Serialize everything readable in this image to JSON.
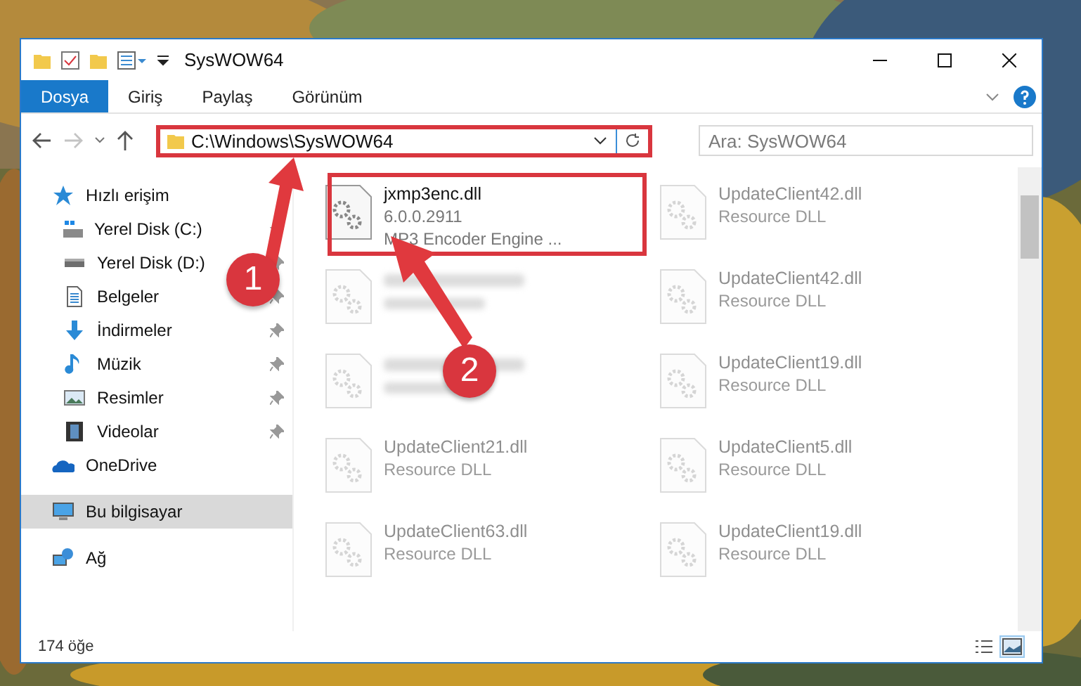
{
  "window": {
    "title": "SysWOW64"
  },
  "ribbon_tabs": [
    {
      "label": "Dosya",
      "kind": "file"
    },
    {
      "label": "Giriş",
      "kind": "tab"
    },
    {
      "label": "Paylaş",
      "kind": "tab"
    },
    {
      "label": "Görünüm",
      "kind": "tab"
    }
  ],
  "navigation": {
    "back": {
      "disabled": false
    },
    "forward": {
      "disabled": true
    }
  },
  "address": {
    "path": "C:\\Windows\\SysWOW64"
  },
  "search": {
    "placeholder": "Ara: SysWOW64"
  },
  "sidebar": {
    "items": [
      {
        "label": "Hızlı erişim",
        "kind": "quick_access",
        "selected": false,
        "children": [
          {
            "label": "Yerel Disk (C:)",
            "kind": "system_drive",
            "pinned": true,
            "selected": false
          },
          {
            "label": "Yerel Disk (D:)",
            "kind": "drive",
            "pinned": true,
            "selected": false
          },
          {
            "label": "Belgeler",
            "kind": "documents",
            "pinned": true,
            "selected": false
          },
          {
            "label": "İndirmeler",
            "kind": "downloads",
            "pinned": true,
            "selected": false
          },
          {
            "label": "Müzik",
            "kind": "music",
            "pinned": true,
            "selected": false
          },
          {
            "label": "Resimler",
            "kind": "pictures",
            "pinned": true,
            "selected": false
          },
          {
            "label": "Videolar",
            "kind": "videos",
            "pinned": true,
            "selected": false
          }
        ]
      },
      {
        "label": "OneDrive",
        "kind": "cloud",
        "selected": false
      },
      {
        "label": "Bu bilgisayar",
        "kind": "computer",
        "selected": true
      },
      {
        "label": "Ağ",
        "kind": "network",
        "selected": false
      }
    ]
  },
  "files": [
    {
      "kind": "file",
      "name": "jxmp3enc.dll",
      "version": "6.0.0.2911",
      "description": "MP3 Encoder Engine ...",
      "blurred": false
    },
    {
      "kind": "file",
      "name": "UpdateClient42.dll",
      "description": "Resource DLL",
      "blurred": true
    },
    {
      "kind": "covered"
    },
    {
      "kind": "file",
      "name": "UpdateClient42.dll",
      "description": "Resource DLL",
      "blurred": true
    },
    {
      "kind": "covered"
    },
    {
      "kind": "file",
      "name": "UpdateClient19.dll",
      "description": "Resource DLL",
      "blurred": true
    },
    {
      "kind": "file",
      "name": "UpdateClient21.dll",
      "description": "Resource DLL",
      "blurred": true
    },
    {
      "kind": "file",
      "name": "UpdateClient5.dll",
      "description": "Resource DLL",
      "blurred": true
    },
    {
      "kind": "file",
      "name": "UpdateClient63.dll",
      "description": "Resource DLL",
      "blurred": true
    },
    {
      "kind": "file",
      "name": "UpdateClient19.dll",
      "description": "Resource DLL",
      "blurred": true
    }
  ],
  "status_bar": {
    "item_count": "174 öğe",
    "views": [
      {
        "kind": "details",
        "selected": false
      },
      {
        "kind": "large_icons",
        "selected": true
      }
    ]
  },
  "annotations": [
    {
      "label": "1"
    },
    {
      "label": "2"
    }
  ]
}
